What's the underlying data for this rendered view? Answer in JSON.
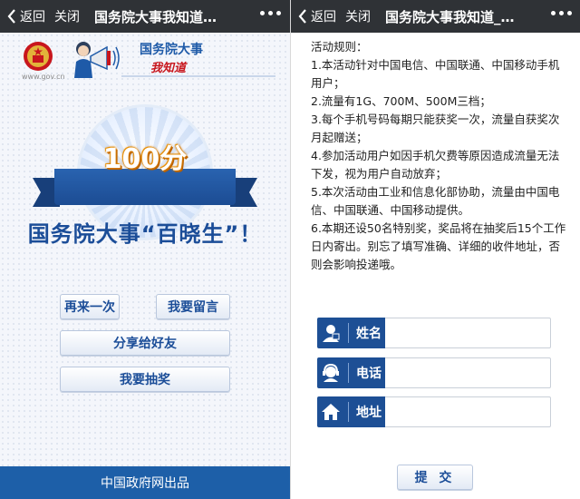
{
  "left_panel": {
    "navbar": {
      "back_label": "返回",
      "close_label": "关闭",
      "title": "国务院大事我知道…",
      "more_icon": "more-dots-icon"
    },
    "logo": {
      "url_text": "www.gov.cn",
      "brand_line_1": "国务院大事",
      "brand_line_2": "我知道"
    },
    "score": "100分",
    "headline": "国务院大事“百晓生”！",
    "buttons": {
      "again": "再来一次",
      "message": "我要留言",
      "share": "分享给好友",
      "draw": "我要抽奖"
    },
    "footer": "中国政府网出品"
  },
  "right_panel": {
    "navbar": {
      "back_label": "返回",
      "close_label": "关闭",
      "title": "国务院大事我知道_…",
      "more_icon": "more-dots-icon"
    },
    "rules": [
      "活动规则：",
      "1.本活动针对中国电信、中国联通、中国移动手机用户；",
      "2.流量有1G、700M、500M三档；",
      "3.每个手机号码每期只能获奖一次，流量自获奖次月起赠送；",
      "4.参加活动用户如因手机欠费等原因造成流量无法下发，视为用户自动放弃；",
      "5.本次活动由工业和信息化部协助，流量由中国电信、中国联通、中国移动提供。",
      "6.本期还设50名特别奖，奖品将在抽奖后15个工作日内寄出。别忘了填写准确、详细的收件地址，否则会影响投递哦。"
    ],
    "form": {
      "name_label": "姓名",
      "name_value": "",
      "name_icon": "user-icon",
      "phone_label": "电话",
      "phone_value": "",
      "phone_icon": "phone-operator-icon",
      "address_label": "地址",
      "address_value": "",
      "address_icon": "home-icon"
    },
    "submit_label": "提 交"
  },
  "colors": {
    "navbar": "#2f3236",
    "brand_blue": "#1d4f95",
    "accent_red": "#c8161d",
    "footer": "#1d5fa8"
  }
}
